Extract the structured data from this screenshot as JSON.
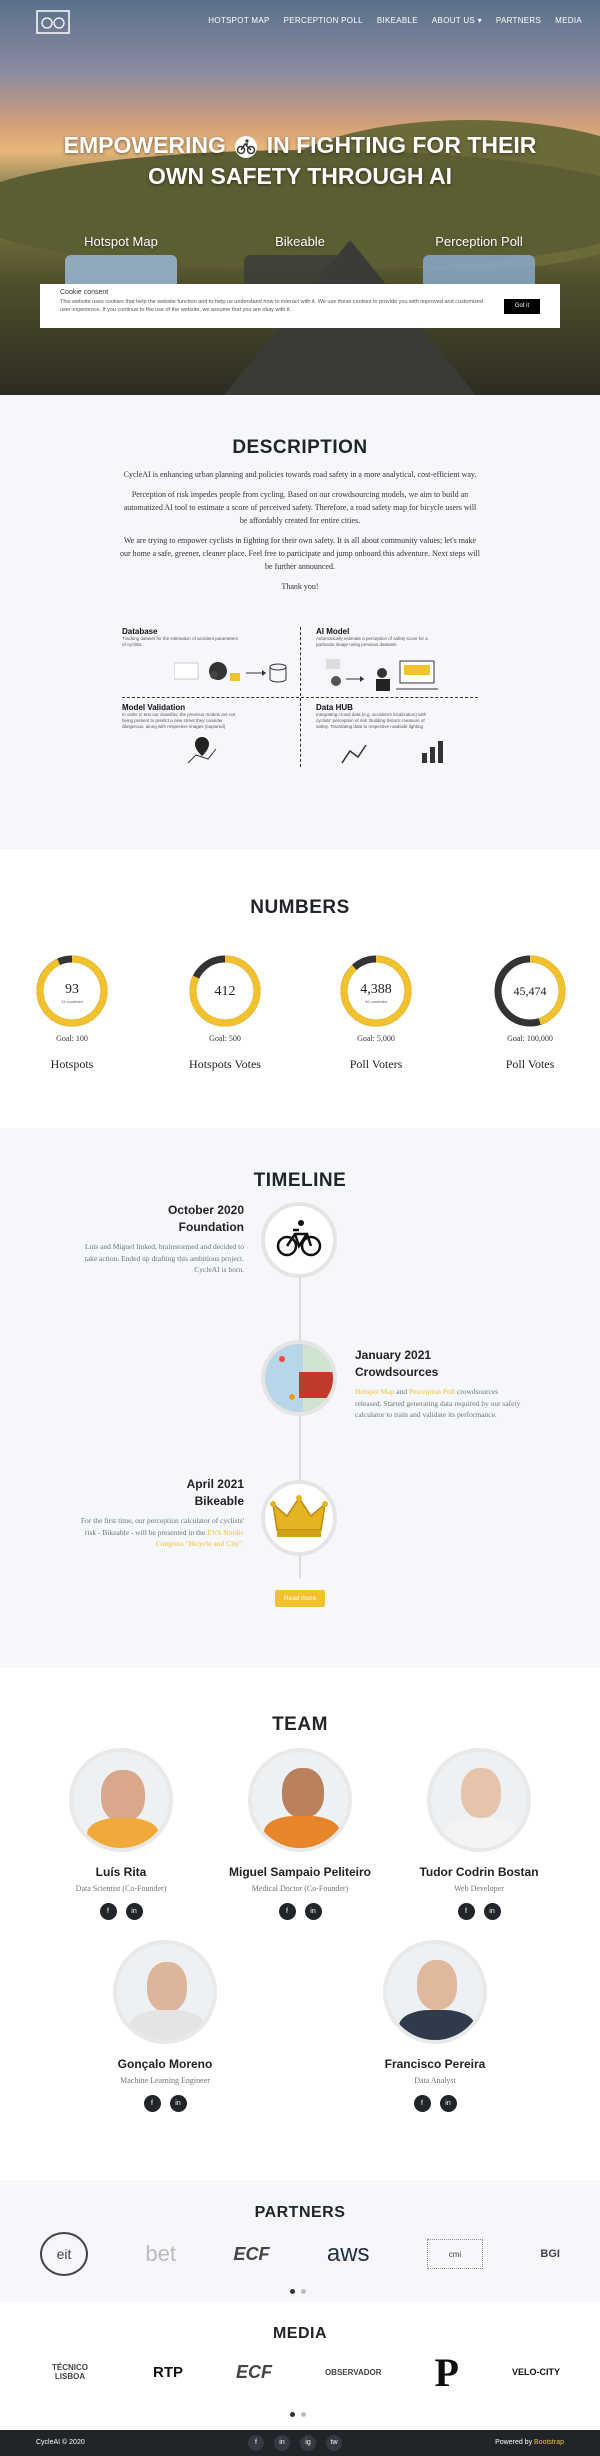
{
  "nav": {
    "links": [
      "HOTSPOT MAP",
      "PERCEPTION POLL",
      "BIKEABLE",
      "ABOUT US ▾",
      "PARTNERS",
      "MEDIA"
    ]
  },
  "hero": {
    "title_line1": "EMPOWERING",
    "title_line1b": "IN FIGHTING FOR THEIR",
    "title_line2": "OWN SAFETY THROUGH AI",
    "cards": [
      "Hotspot Map",
      "Bikeable",
      "Perception Poll"
    ]
  },
  "cookie": {
    "title": "Cookie consent",
    "text": "This website uses cookies that help the website function and to help us understand how to interact with it. We use these cookies to provide you with improved and customized user-experience. If you continue to the use of the website, we assume that you are okay with it.",
    "button": "Got it"
  },
  "description": {
    "title": "DESCRIPTION",
    "p1": "CycleAI is enhancing urban planning and policies towards road safety in a more analytical, cost-efficient way.",
    "p2": "Perception of risk impedes people from cycling. Based on our crowdsourcing models, we aim to build an automatized AI tool to estimate a score of perceived safety. Therefore, a road safety map for bicycle users will be affordably created for entire cities.",
    "p3": "We are trying to empower cyclists in fighting for their own safety. It is all about community values; let's make our home a safe, greener, cleaner place. Feel free to participate and jump onboard this adventure. Next steps will be further announced.",
    "p4": "Thank you!",
    "diagram": {
      "database": {
        "title": "Database",
        "text": "Tracking dataset for the estimation of accident parameters of cyclists"
      },
      "ai_model": {
        "title": "AI Model",
        "text": "Automatically estimate a perception of safety score for a particular image using previous datasets"
      },
      "validation": {
        "title": "Model Validation",
        "text": "In order to test our classifier, the previous models are not being present to predict a new street they consider dangerous, along with respective images (captured)"
      },
      "data_hub": {
        "title": "Data HUB",
        "text": "Integrating crowd data (e.g. accident's localization) with cyclists' perception of risk. Building historic measure of safety. Translating data to respective roadside lighting"
      }
    }
  },
  "numbers": {
    "title": "NUMBERS",
    "items": [
      {
        "value": "93",
        "sub": "11 countries",
        "goal": "Goal: 100",
        "name": "Hotspots",
        "fraction": 0.93
      },
      {
        "value": "412",
        "sub": "",
        "goal": "Goal: 500",
        "name": "Hotspots Votes",
        "fraction": 0.82
      },
      {
        "value": "4,388",
        "sub": "40 countries",
        "goal": "Goal: 5,000",
        "name": "Poll Voters",
        "fraction": 0.88
      },
      {
        "value": "45,474",
        "sub": "",
        "goal": "Goal: 100,000",
        "name": "Poll Votes",
        "fraction": 0.45
      }
    ],
    "accent": "#f2c12e",
    "track": "#333333"
  },
  "timeline": {
    "title": "TIMELINE",
    "e1": {
      "date": "October 2020",
      "name": "Foundation",
      "text": "Luís and Miguel linked, brainstormed and decided to take action. Ended up drafting this ambitious project. CycleAI is born."
    },
    "e2": {
      "date": "January 2021",
      "name": "Crowdsources",
      "link1": "Hotspot Map",
      "and": "and",
      "link2": "Perception Poll",
      "text": "crowdsources released. Started generating data required by our safety calculator to train and validate its performance."
    },
    "e3": {
      "date": "April 2021",
      "name": "Bikeable",
      "text": "For the first time, our perception calculator of cyclists' risk - Bikeable - will be presented in the",
      "link": "EVS Nordic Congress \"Bicycle and City\"."
    },
    "read_more": "Read more"
  },
  "team": {
    "title": "TEAM",
    "members": [
      {
        "name": "Luís Rita",
        "role": "Data Scientist (Co-Founder)"
      },
      {
        "name": "Miguel Sampaio Peliteiro",
        "role": "Medical Doctor (Co-Founder)"
      },
      {
        "name": "Tudor Codrin Bostan",
        "role": "Web Developer"
      },
      {
        "name": "Gonçalo Moreno",
        "role": "Machine Learning Engineer"
      },
      {
        "name": "Francisco Pereira",
        "role": "Data Analyst"
      }
    ],
    "social": {
      "fb": "f",
      "in": "in"
    }
  },
  "partners": {
    "title": "PARTNERS",
    "logos": [
      "eit",
      "bet",
      "ECF",
      "aws",
      "cmi",
      "BGI"
    ]
  },
  "media": {
    "title": "MEDIA",
    "logos": [
      "TÉCNICO LISBOA",
      "RTP",
      "ECF",
      "OBSERVADOR",
      "P",
      "VELO-CITY"
    ]
  },
  "footer": {
    "copy": "CycleAI © 2020",
    "powered": "Powered by",
    "powered_link": "Bootstrap",
    "social": [
      "f",
      "in",
      "ig",
      "tw"
    ]
  }
}
